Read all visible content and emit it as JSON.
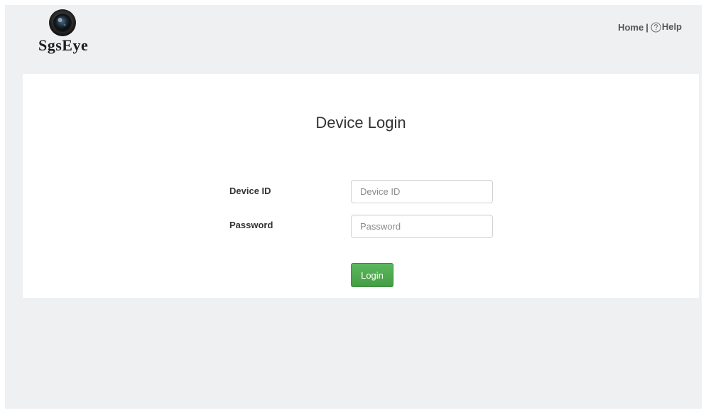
{
  "header": {
    "logo_text": "SgsEye",
    "nav": {
      "home_label": "Home",
      "separator": "|",
      "help_label": "Help"
    }
  },
  "login": {
    "title": "Device Login",
    "device_id": {
      "label": "Device ID",
      "placeholder": "Device ID",
      "value": ""
    },
    "password": {
      "label": "Password",
      "placeholder": "Password",
      "value": ""
    },
    "submit_label": "Login"
  },
  "colors": {
    "accent_green": "#5cb85c",
    "page_background": "#eef0f2",
    "panel_background": "#ffffff"
  },
  "icons": [
    "camera-lens-icon",
    "help-icon"
  ]
}
